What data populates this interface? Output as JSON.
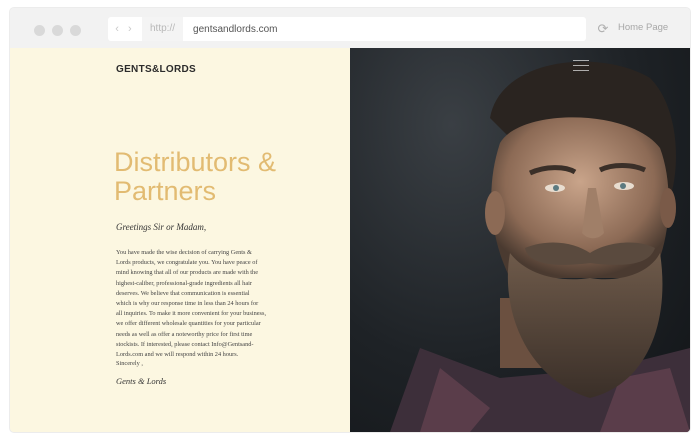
{
  "browser": {
    "protocol": "http://",
    "url": "gentsandlords.com",
    "home_link": "Home Page",
    "nav_arrows": "‹ ›",
    "refresh_glyph": "⟳"
  },
  "site": {
    "logo": "GENTS&LORDS",
    "headline": "Distributors & Partners",
    "greeting": "Greetings Sir or Madam,",
    "body": "You have made the wise decision of carrying Gents & Lords products, we congratulate you. You have peace of mind knowing that all of our products are made with the highest-caliber, professional-grade ingredients all hair deserves. We believe that communication is essential which is why our response time in less than 24 hours for all inquiries. To make it more convenient for your business, we offer different wholesale quantities for your particular needs as well as offer a noteworthy price for first time stockists. If interested, please contact Info@Gentsand-Lords.com and we will respond within 24 hours.",
    "signoff": "Sincerely ,",
    "signature": "Gents & Lords"
  },
  "colors": {
    "accent": "#e2bb72",
    "left_background": "#fcf7e1",
    "dark_panel": "#1e2226"
  },
  "icons": {
    "window_controls": [
      "dot",
      "dot",
      "dot"
    ],
    "menu": "hamburger-icon",
    "reload": "refresh-icon",
    "back_forward": "nav-arrows-icon"
  }
}
